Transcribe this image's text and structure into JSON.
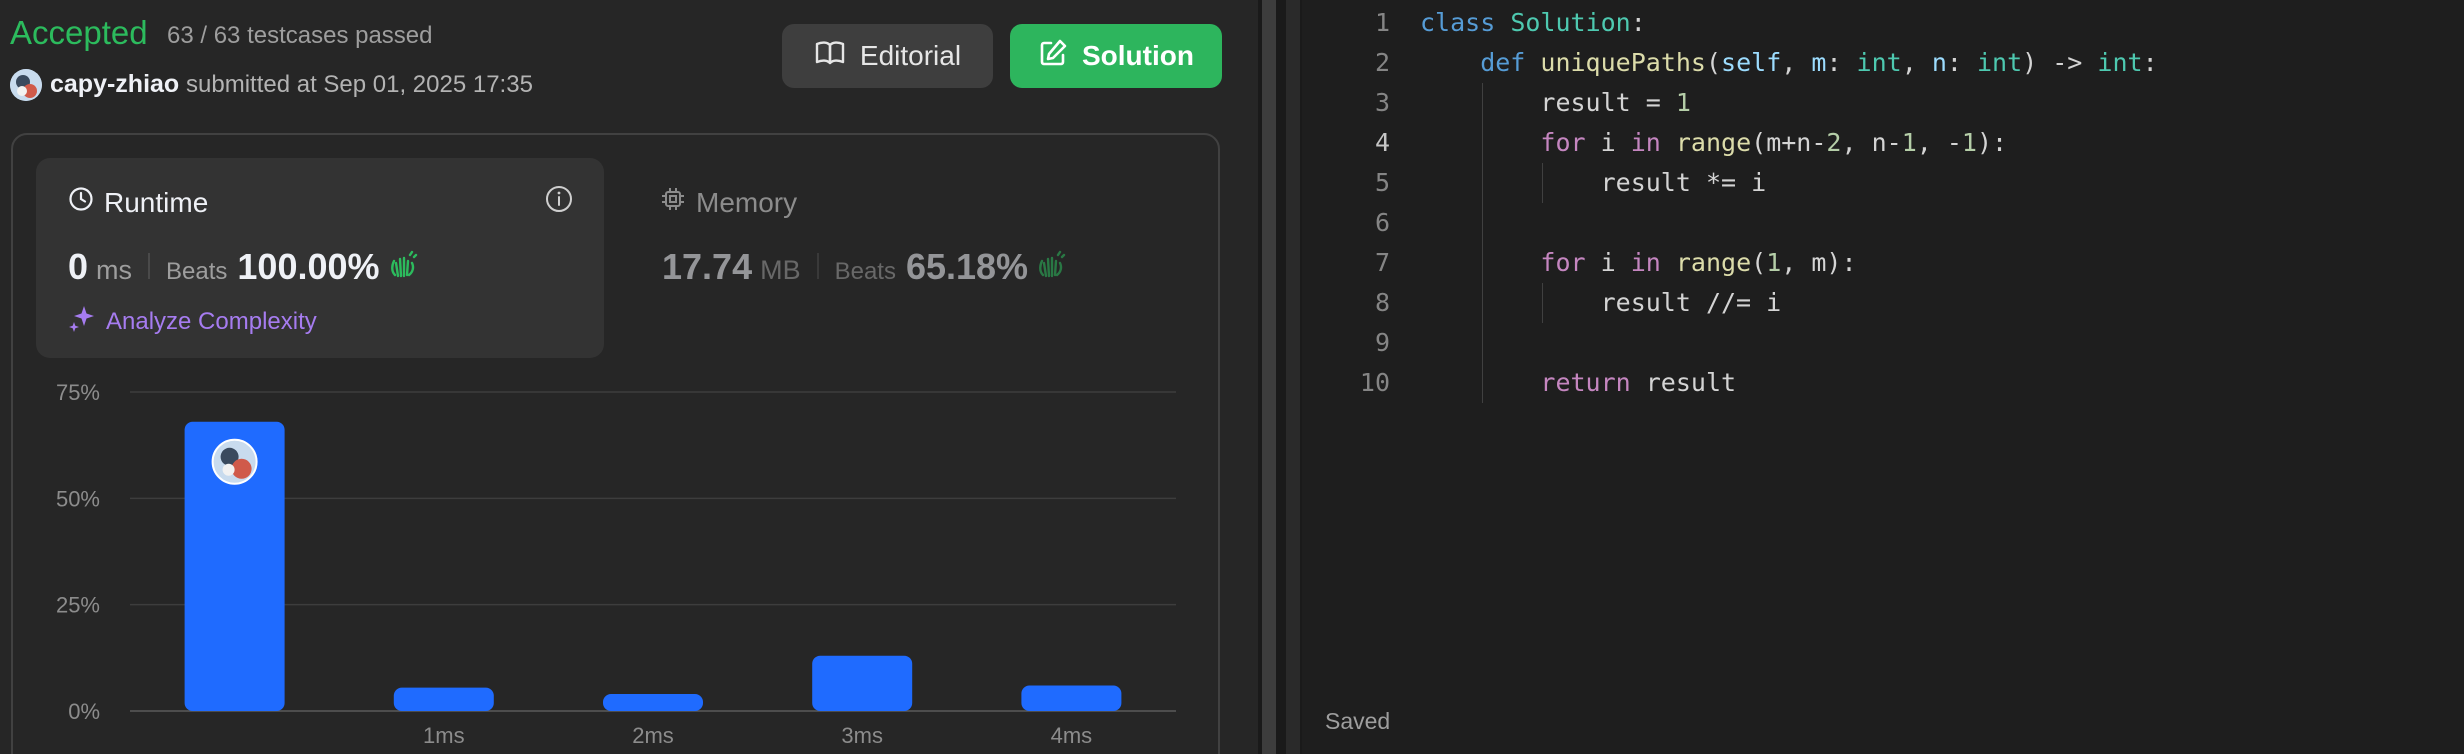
{
  "submission": {
    "status": "Accepted",
    "testcases": "63 / 63 testcases passed",
    "username": "capy-zhiao",
    "submitted_at": "submitted at Sep 01, 2025 17:35"
  },
  "buttons": {
    "editorial": "Editorial",
    "solution": "Solution"
  },
  "runtime": {
    "title": "Runtime",
    "value": "0",
    "unit": "ms",
    "beats_label": "Beats",
    "beats_pct": "100.00%",
    "analyze": "Analyze Complexity"
  },
  "memory": {
    "title": "Memory",
    "value": "17.74",
    "unit": "MB",
    "beats_label": "Beats",
    "beats_pct": "65.18%"
  },
  "colors": {
    "accepted": "#2cbb5d",
    "solution_button": "#2db55d",
    "bar": "#1f6bff",
    "analyze": "#a67cf0"
  },
  "icons": [
    "book-icon",
    "edit-icon",
    "clock-icon",
    "info-icon",
    "chip-icon",
    "clap-icon",
    "sparkle-icon"
  ],
  "chart_data": {
    "type": "bar",
    "categories": [
      "",
      "1ms",
      "2ms",
      "3ms",
      "4ms"
    ],
    "values": [
      68,
      5.5,
      4,
      13,
      6
    ],
    "ylim": [
      0,
      75
    ],
    "yticks": [
      "0%",
      "25%",
      "50%",
      "75%"
    ],
    "highlight_index": 0,
    "grid": true
  },
  "editor": {
    "active_line": 4,
    "saved": "Saved",
    "lines": [
      {
        "n": "1",
        "indent": 0,
        "tokens": [
          {
            "t": "class",
            "c": "kw"
          },
          {
            "t": " "
          },
          {
            "t": "Solution",
            "c": "cls"
          },
          {
            "t": ":"
          }
        ]
      },
      {
        "n": "2",
        "indent": 1,
        "tokens": [
          {
            "t": "def",
            "c": "kw"
          },
          {
            "t": " "
          },
          {
            "t": "uniquePaths",
            "c": "fn"
          },
          {
            "t": "("
          },
          {
            "t": "self",
            "c": "param"
          },
          {
            "t": ", "
          },
          {
            "t": "m",
            "c": "param"
          },
          {
            "t": ": "
          },
          {
            "t": "int",
            "c": "cls"
          },
          {
            "t": ", "
          },
          {
            "t": "n",
            "c": "param"
          },
          {
            "t": ": "
          },
          {
            "t": "int",
            "c": "cls"
          },
          {
            "t": ") -> "
          },
          {
            "t": "int",
            "c": "cls"
          },
          {
            "t": ":"
          }
        ]
      },
      {
        "n": "3",
        "indent": 2,
        "tokens": [
          {
            "t": "result = "
          },
          {
            "t": "1",
            "c": "num"
          }
        ]
      },
      {
        "n": "4",
        "indent": 2,
        "tokens": [
          {
            "t": "for",
            "c": "ctrl"
          },
          {
            "t": " i "
          },
          {
            "t": "in",
            "c": "ctrl"
          },
          {
            "t": " "
          },
          {
            "t": "range",
            "c": "fn"
          },
          {
            "t": "(m+n-"
          },
          {
            "t": "2",
            "c": "num"
          },
          {
            "t": ", n-"
          },
          {
            "t": "1",
            "c": "num"
          },
          {
            "t": ", -"
          },
          {
            "t": "1",
            "c": "num"
          },
          {
            "t": "):"
          }
        ]
      },
      {
        "n": "5",
        "indent": 3,
        "tokens": [
          {
            "t": "result *= i"
          }
        ]
      },
      {
        "n": "6",
        "indent": 2,
        "tokens": []
      },
      {
        "n": "7",
        "indent": 2,
        "tokens": [
          {
            "t": "for",
            "c": "ctrl"
          },
          {
            "t": " i "
          },
          {
            "t": "in",
            "c": "ctrl"
          },
          {
            "t": " "
          },
          {
            "t": "range",
            "c": "fn"
          },
          {
            "t": "("
          },
          {
            "t": "1",
            "c": "num"
          },
          {
            "t": ", m):"
          }
        ]
      },
      {
        "n": "8",
        "indent": 3,
        "tokens": [
          {
            "t": "result //= i"
          }
        ]
      },
      {
        "n": "9",
        "indent": 2,
        "tokens": []
      },
      {
        "n": "10",
        "indent": 2,
        "tokens": [
          {
            "t": "return",
            "c": "ctrl"
          },
          {
            "t": " result"
          }
        ]
      }
    ]
  }
}
